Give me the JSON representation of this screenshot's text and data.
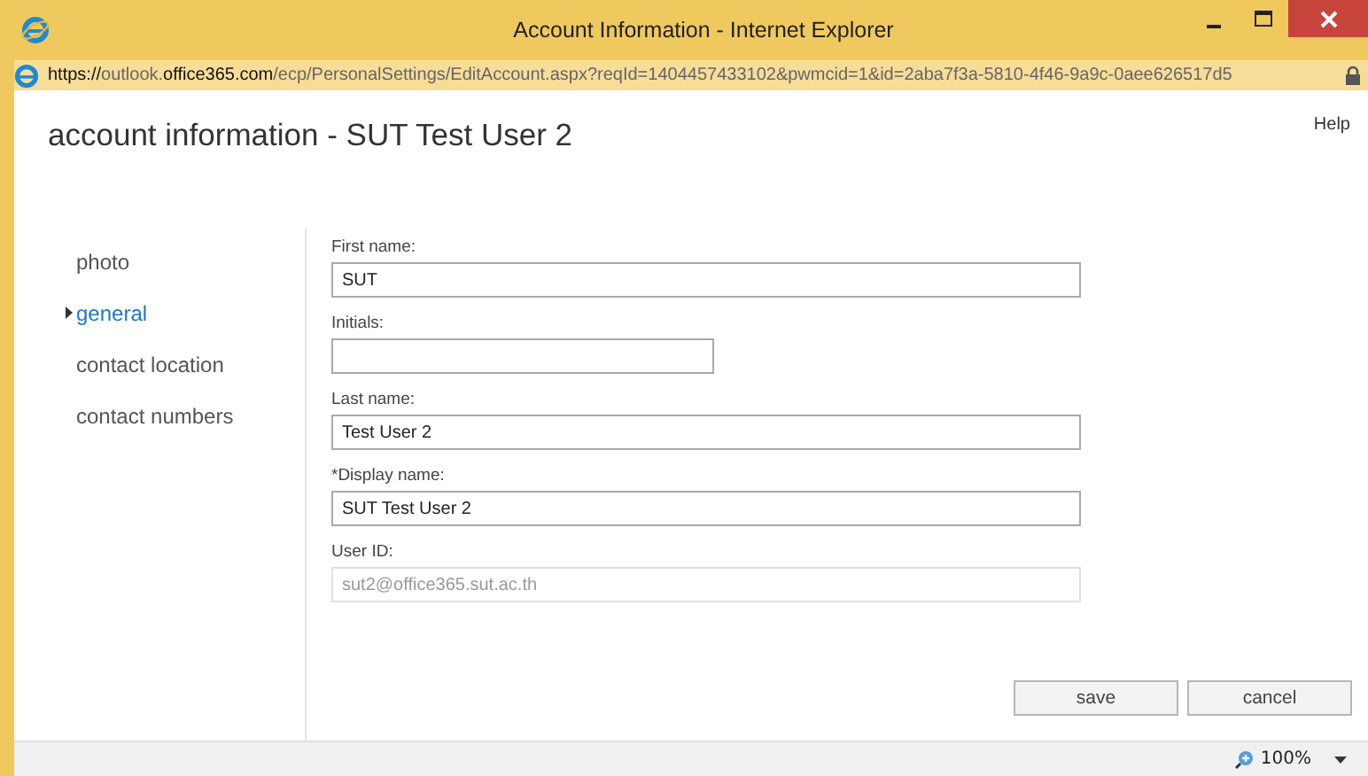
{
  "window": {
    "title": "Account Information - Internet Explorer"
  },
  "address_bar": {
    "url": [
      {
        "text": "https://",
        "strong": true
      },
      {
        "text": "outlook.",
        "strong": false
      },
      {
        "text": "office365.com",
        "strong": true
      },
      {
        "text": "/ecp/PersonalSettings/EditAccount.aspx?reqId=1404457433102&pwmcid=1&id=2aba7f3a-5810-4f46-9a9c-0aee626517d5",
        "strong": false
      }
    ]
  },
  "help": "Help",
  "heading": "account information - SUT Test User 2",
  "nav": [
    {
      "label": "photo",
      "selected": false
    },
    {
      "label": "general",
      "selected": true
    },
    {
      "label": "contact location",
      "selected": false
    },
    {
      "label": "contact numbers",
      "selected": false
    }
  ],
  "fields": [
    {
      "label": "First name:",
      "value": "SUT",
      "kind": "full",
      "disabled": false
    },
    {
      "label": "Initials:",
      "kind": "short",
      "disabled": false
    },
    {
      "label": "Last name:",
      "value": "Test User 2",
      "kind": "full",
      "disabled": false
    },
    {
      "label": "*Display name:",
      "value": "SUT Test User 2",
      "kind": "full",
      "disabled": false
    },
    {
      "label": "User ID:",
      "value": "sut2@office365.sut.ac.th",
      "kind": "full",
      "disabled": true
    }
  ],
  "buttons": [
    "save",
    "cancel"
  ],
  "status_bar": {
    "zoom": "100%"
  }
}
